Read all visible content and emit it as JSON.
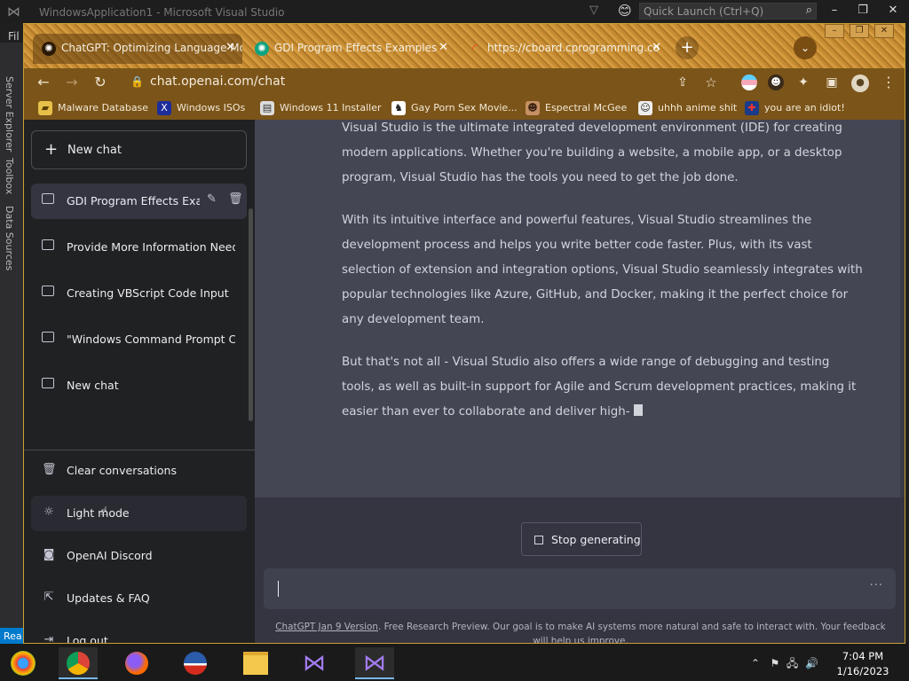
{
  "vs": {
    "title": "WindowsApplication1 - Microsoft Visual Studio",
    "quick_launch_placeholder": "Quick Launch (Ctrl+Q)",
    "menu_partial": "Fil",
    "side_tabs": [
      "Server Explorer",
      "Toolbox",
      "Data Sources"
    ],
    "status_partial": "Rea"
  },
  "browser": {
    "tabs": [
      {
        "title": "ChatGPT: Optimizing Language Mo",
        "icon": "chatgpt-icon",
        "active": true
      },
      {
        "title": "GDI Program Effects Examples",
        "icon": "chatgpt-icon",
        "active": false
      },
      {
        "title": "https://cboard.cprogramming.co",
        "icon": "loading-icon",
        "active": false
      }
    ],
    "address": "chat.openai.com/chat",
    "bookmarks": [
      {
        "label": "Malware Database",
        "icon": "folder-icon"
      },
      {
        "label": "Windows ISOs",
        "icon": "x-icon"
      },
      {
        "label": "Windows 11 Installer",
        "icon": "window-icon"
      },
      {
        "label": "Gay Porn Sex Movie...",
        "icon": "bookmark-icon"
      },
      {
        "label": "Espectral McGee",
        "icon": "avatar-icon"
      },
      {
        "label": "uhhh anime shit",
        "icon": "avatar-icon"
      },
      {
        "label": "you are an idiot!",
        "icon": "flag-icon"
      }
    ]
  },
  "sidebar": {
    "new_chat": "New chat",
    "conversations": [
      {
        "label": "GDI Program Effects Exam",
        "active": true
      },
      {
        "label": "Provide More Information Neede",
        "active": false
      },
      {
        "label": "Creating VBScript Code Input",
        "active": false
      },
      {
        "label": "\"Windows Command Prompt C D",
        "active": false
      },
      {
        "label": "New chat",
        "active": false
      }
    ],
    "actions": [
      {
        "label": "Clear conversations",
        "icon": "trash-icon"
      },
      {
        "label": "Light mode",
        "icon": "sun-icon"
      },
      {
        "label": "OpenAI Discord",
        "icon": "discord-icon"
      },
      {
        "label": "Updates & FAQ",
        "icon": "external-link-icon"
      },
      {
        "label": "Log out",
        "icon": "logout-icon"
      }
    ]
  },
  "chat": {
    "paragraphs": [
      "Visual Studio is the ultimate integrated development environment (IDE) for creating modern applications. Whether you're building a website, a mobile app, or a desktop program, Visual Studio has the tools you need to get the job done.",
      "With its intuitive interface and powerful features, Visual Studio streamlines the development process and helps you write better code faster. Plus, with its vast selection of extension and integration options, Visual Studio seamlessly integrates with popular technologies like Azure, GitHub, and Docker, making it the perfect choice for any development team.",
      "But that's not all - Visual Studio also offers a wide range of debugging and testing tools, as well as built-in support for Agile and Scrum development practices, making it easier than ever to collaborate and deliver high-"
    ],
    "stop_button": "Stop generating",
    "input_value": "",
    "footer_link": "ChatGPT Jan 9 Version",
    "footer_text": ". Free Research Preview. Our goal is to make AI systems more natural and safe to interact with. Your feedback will help us improve."
  },
  "taskbar": {
    "time": "7:04 PM",
    "date": "1/16/2023"
  },
  "colors": {
    "sidebar_bg": "#202123",
    "main_bg": "#343541",
    "message_bg": "#444654",
    "browser_accent": "#7b5419"
  }
}
